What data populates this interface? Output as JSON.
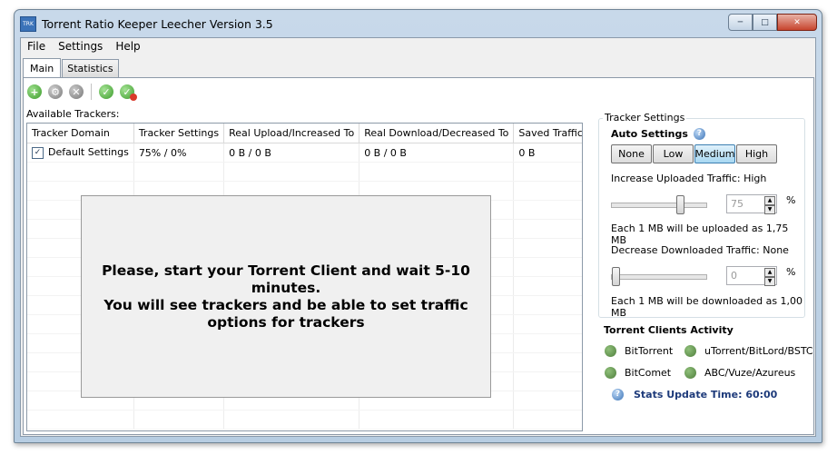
{
  "window": {
    "title": "Torrent Ratio Keeper Leecher Version  3.5",
    "icon_label": "TRK",
    "controls": [
      "minimize-icon",
      "maximize-icon",
      "close-icon"
    ]
  },
  "menu": [
    "File",
    "Settings",
    "Help"
  ],
  "tabs": [
    {
      "label": "Main",
      "active": true
    },
    {
      "label": "Statistics",
      "active": false
    }
  ],
  "toolbar": {
    "icons": [
      "add-icon",
      "gear-icon",
      "delete-icon",
      "check-icon",
      "check-remove-icon"
    ]
  },
  "trackers": {
    "label": "Available Trackers:",
    "columns": [
      "Tracker Domain",
      "Tracker Settings",
      "Real Upload/Increased To",
      "Real Download/Decreased To",
      "Saved Traffic"
    ],
    "rows": [
      {
        "checked": true,
        "domain": "Default Settings",
        "settings": "75% / 0%",
        "upload": "0 B / 0 B",
        "download": "0 B / 0 B",
        "saved": "0 B"
      }
    ]
  },
  "message": {
    "line1": "Please, start your Torrent Client and wait 5-10 minutes.",
    "line2": "You will see trackers and be able to set traffic options for trackers"
  },
  "tracker_settings": {
    "legend": "Tracker Settings",
    "auto_label": "Auto Settings",
    "presets": [
      "None",
      "Low",
      "Medium",
      "High"
    ],
    "selected_preset": "Medium",
    "upload": {
      "label": "Increase Uploaded Traffic: High",
      "value": "75",
      "level": 0.75,
      "unit": "%",
      "note": "Each 1 MB will be uploaded as 1,75 MB"
    },
    "download": {
      "label": "Decrease Downloaded Traffic: None",
      "value": "0",
      "level": 0,
      "unit": "%",
      "note": "Each 1 MB will be downloaded as 1,00 MB"
    }
  },
  "activity": {
    "title": "Torrent Clients Activity",
    "clients": [
      "BitTorrent",
      "uTorrent/BitLord/BSTC",
      "BitComet",
      "ABC/Vuze/Azureus"
    ],
    "status_color": "#4f7f3c"
  },
  "stats": {
    "label": "Stats Update Time: 60:00"
  }
}
